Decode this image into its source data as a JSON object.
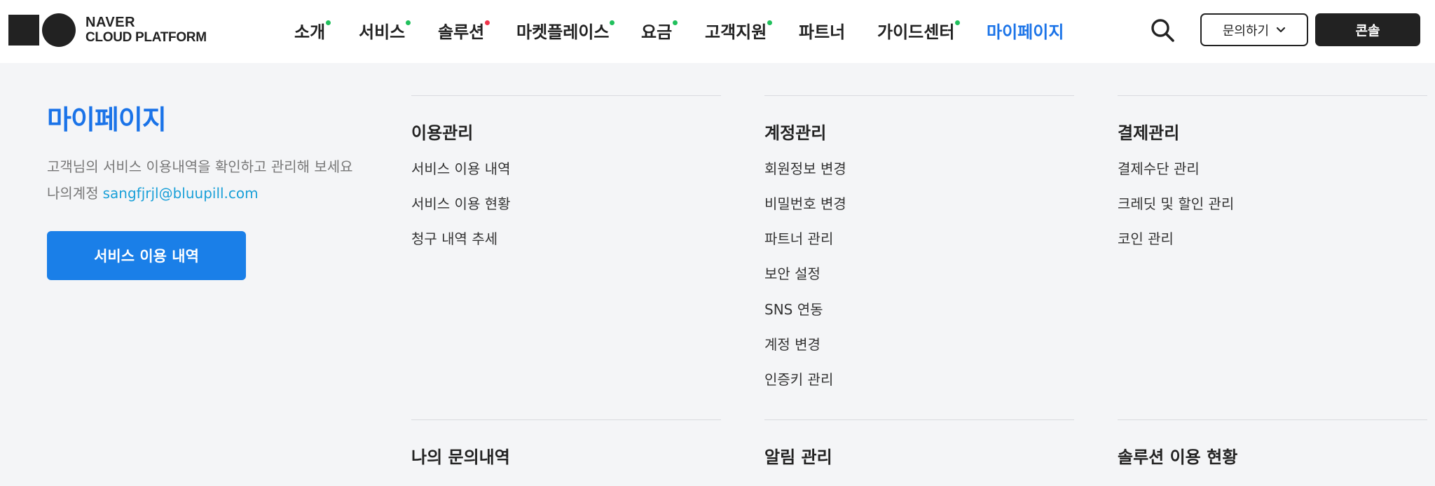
{
  "logo": {
    "line1": "NAVER",
    "line2": "CLOUD PLATFORM"
  },
  "nav": {
    "items": [
      {
        "label": "소개",
        "dot_color": "#20c05c"
      },
      {
        "label": "서비스",
        "dot_color": "#20c05c"
      },
      {
        "label": "솔루션",
        "dot_color": "#f0344a"
      },
      {
        "label": "마켓플레이스",
        "dot_color": "#20c05c"
      },
      {
        "label": "요금",
        "dot_color": "#20c05c"
      },
      {
        "label": "고객지원",
        "dot_color": "#20c05c"
      },
      {
        "label": "파트너",
        "dot_color": null
      },
      {
        "label": "가이드센터",
        "dot_color": "#20c05c"
      },
      {
        "label": "마이페이지",
        "dot_color": null,
        "active": true
      }
    ],
    "active_color": "#1a73e8"
  },
  "header_actions": {
    "search_icon": "search-icon",
    "inquiry_label": "문의하기",
    "console_label": "콘솔"
  },
  "mypage": {
    "title": "마이페이지",
    "description": "고객님의 서비스 이용내역을 확인하고 관리해 보세요",
    "account_label": "나의계정",
    "account_email": "sangfjrjl@bluupill.com",
    "primary_button": "서비스 이용 내역"
  },
  "menu_sections": [
    {
      "title": "이용관리",
      "links": [
        "서비스 이용 내역",
        "서비스 이용 현황",
        "청구 내역 추세"
      ]
    },
    {
      "title": "계정관리",
      "links": [
        "회원정보 변경",
        "비밀번호 변경",
        "파트너 관리",
        "보안 설정",
        "SNS 연동",
        "계정 변경",
        "인증키 관리"
      ]
    },
    {
      "title": "결제관리",
      "links": [
        "결제수단 관리",
        "크레딧 및 할인 관리",
        "코인 관리"
      ]
    },
    {
      "title": "나의 문의내역",
      "links": []
    },
    {
      "title": "알림 관리",
      "links": []
    },
    {
      "title": "솔루션 이용 현황",
      "links": []
    }
  ],
  "colors": {
    "brand_blue": "#1a73e8",
    "button_blue": "#1a7fe8",
    "email_link": "#1aa0d8",
    "background": "#f4f5f7",
    "dark": "#222222"
  }
}
